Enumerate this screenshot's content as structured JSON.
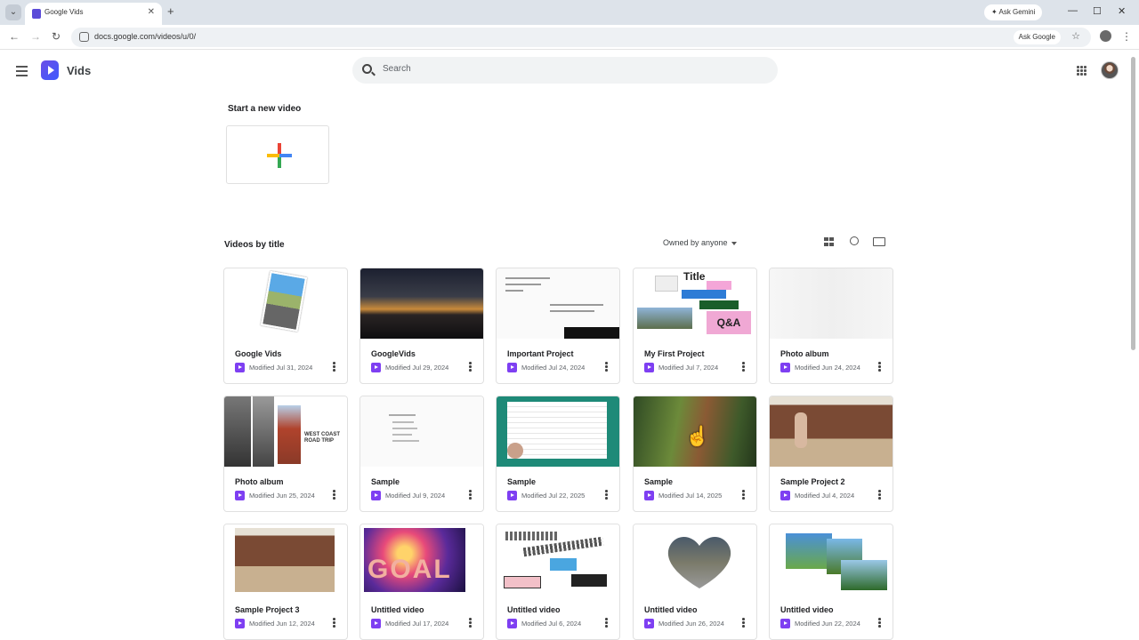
{
  "browser": {
    "tab_title": "Google Vids",
    "url": "docs.google.com/videos/u/0/",
    "ask_gemini": "Ask Gemini",
    "ask_google": "Ask Google"
  },
  "app": {
    "name": "Vids",
    "search_placeholder": "Search"
  },
  "start": {
    "title": "Start a new video"
  },
  "list": {
    "title": "Videos by title",
    "owner_filter": "Owned by anyone"
  },
  "cards": [
    {
      "title": "Google Vids",
      "modified": "Modified Jul 31, 2024"
    },
    {
      "title": "GoogleVids",
      "modified": "Modified Jul 29, 2024"
    },
    {
      "title": "Important Project",
      "modified": "Modified Jul 24, 2024"
    },
    {
      "title": "My First Project",
      "modified": "Modified Jul 7, 2024"
    },
    {
      "title": "Photo album",
      "modified": "Modified Jun 24, 2024"
    },
    {
      "title": "Photo album",
      "modified": "Modified Jun 25, 2024"
    },
    {
      "title": "Sample",
      "modified": "Modified Jul 9, 2024"
    },
    {
      "title": "Sample",
      "modified": "Modified Jul 22, 2025"
    },
    {
      "title": "Sample",
      "modified": "Modified Jul 14, 2025"
    },
    {
      "title": "Sample Project 2",
      "modified": "Modified Jul 4, 2024"
    },
    {
      "title": "Sample Project 3",
      "modified": "Modified Jun 12, 2024"
    },
    {
      "title": "Untitled video",
      "modified": "Modified Jul 17, 2024"
    },
    {
      "title": "Untitled video",
      "modified": "Modified Jul 6, 2024"
    },
    {
      "title": "Untitled video",
      "modified": "Modified Jun 26, 2024"
    },
    {
      "title": "Untitled video",
      "modified": "Modified Jun 22, 2024"
    }
  ],
  "thumb_texts": {
    "goal": "GOAL",
    "roadtrip": "WEST COAST ROAD TRIP",
    "title_word": "Title",
    "qa": "Q&A"
  }
}
